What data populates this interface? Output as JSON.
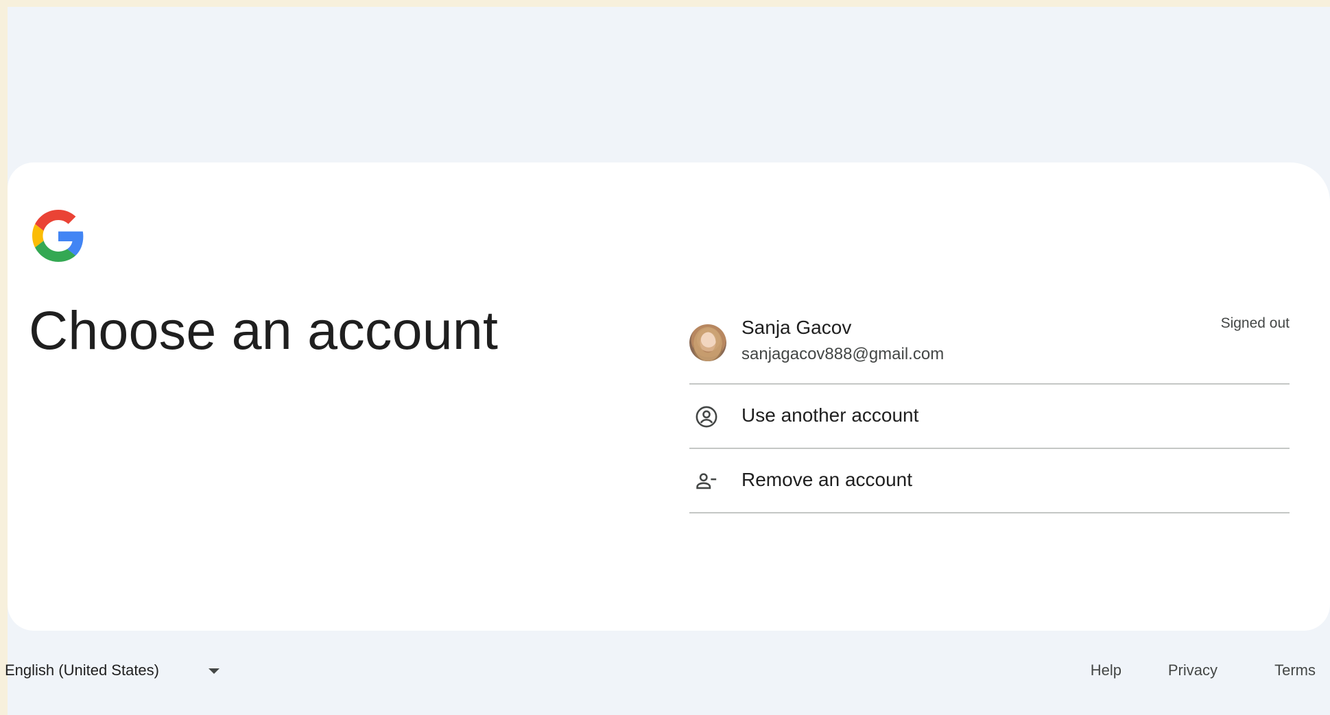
{
  "page": {
    "title": "Choose an account"
  },
  "account": {
    "name": "Sanja Gacov",
    "email": "sanjagacov888@gmail.com",
    "status": "Signed out"
  },
  "actions": {
    "use_another": "Use another account",
    "remove": "Remove an account"
  },
  "footer": {
    "language": "English (United States)",
    "help": "Help",
    "privacy": "Privacy",
    "terms": "Terms"
  },
  "colors": {
    "background": "#f0f4f9",
    "card": "#ffffff",
    "divider": "#c4c7c5",
    "google_blue": "#4285F4",
    "google_red": "#EA4335",
    "google_yellow": "#FBBC05",
    "google_green": "#34A853"
  },
  "icons": {
    "logo": "google-g-icon",
    "use_another": "account-circle-icon",
    "remove": "person-remove-icon",
    "language": "caret-down-icon"
  }
}
